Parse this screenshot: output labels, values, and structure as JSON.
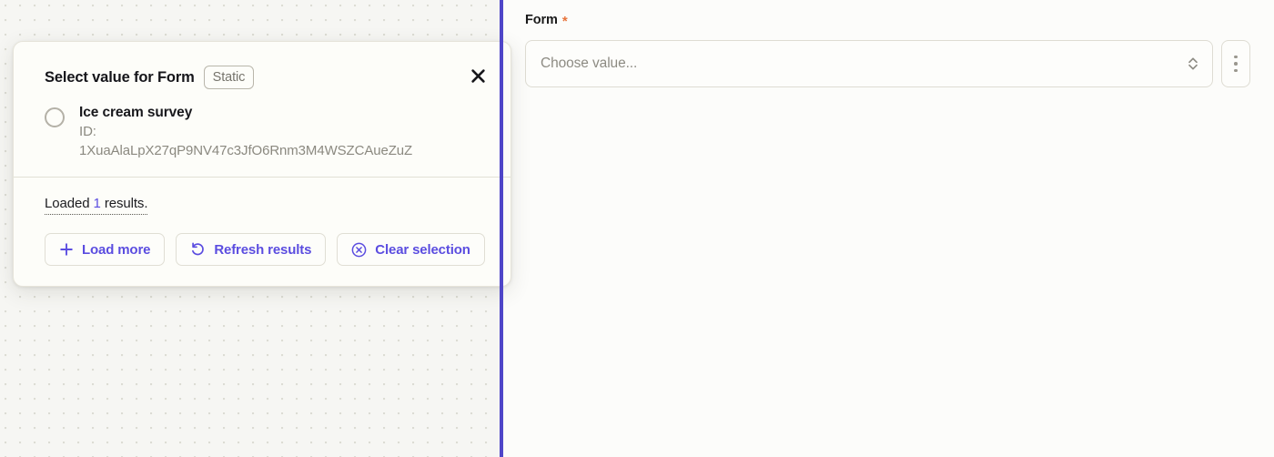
{
  "form_panel": {
    "field_label": "Form",
    "required_marker": "*",
    "select_placeholder": "Choose value...",
    "select_chevron_icon": "chevron-up-down-icon",
    "kebab_icon": "vertical-dots-icon"
  },
  "popover": {
    "title": "Select value for Form",
    "badge": "Static",
    "close_icon": "close-icon",
    "options": [
      {
        "title": "Ice cream survey",
        "id_label": "ID:",
        "id_value": "1XuaAlaLpX27qP9NV47c3JfO6Rnm3M4WSZCAueZuZ",
        "selected": false
      }
    ],
    "status": {
      "prefix": "Loaded ",
      "count": "1",
      "suffix": " results."
    },
    "buttons": [
      {
        "label": "Load more",
        "icon": "plus-icon"
      },
      {
        "label": "Refresh results",
        "icon": "refresh-icon"
      },
      {
        "label": "Clear selection",
        "icon": "circle-x-icon"
      }
    ]
  },
  "colors": {
    "accent_purple": "#5b4de0",
    "divider_purple": "#4f46c8",
    "required_orange": "#e8743b"
  }
}
